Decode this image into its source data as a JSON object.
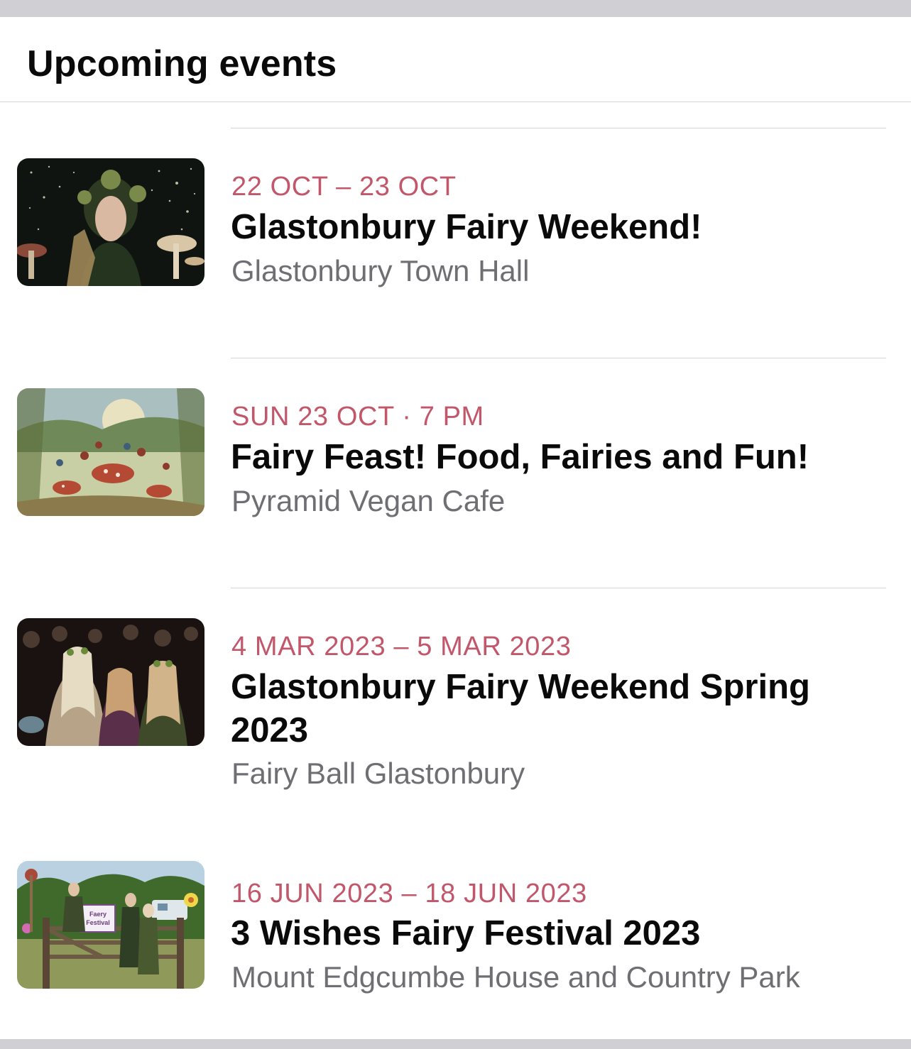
{
  "section": {
    "title": "Upcoming events"
  },
  "events": [
    {
      "date": "22 OCT – 23 OCT",
      "title": "Glastonbury Fairy Weekend!",
      "venue": "Glastonbury Town Hall",
      "image": "fairy-woman-with-mushrooms-photo"
    },
    {
      "date": "SUN 23 OCT · 7 PM",
      "title": "Fairy Feast! Food, Fairies and Fun!",
      "venue": "Pyramid Vegan Cafe",
      "image": "fairy-dance-illustration"
    },
    {
      "date": "4 MAR 2023 – 5 MAR 2023",
      "title": "Glastonbury Fairy Weekend Spring 2023",
      "venue": "Fairy Ball Glastonbury",
      "image": "fairy-ball-crowd-photo"
    },
    {
      "date": "16 JUN 2023 – 18 JUN 2023",
      "title": "3 Wishes Fairy Festival 2023",
      "venue": "Mount Edgcumbe House and Country Park",
      "image": "fairy-festival-gate-photo",
      "image_sign_text": "Faery Festival"
    }
  ],
  "colors": {
    "date_accent": "#c2566a",
    "title_text": "#0a0a0a",
    "venue_text": "#6e6e73",
    "separator": "#d4d4d8",
    "background_frame": "#cfcfd4"
  }
}
